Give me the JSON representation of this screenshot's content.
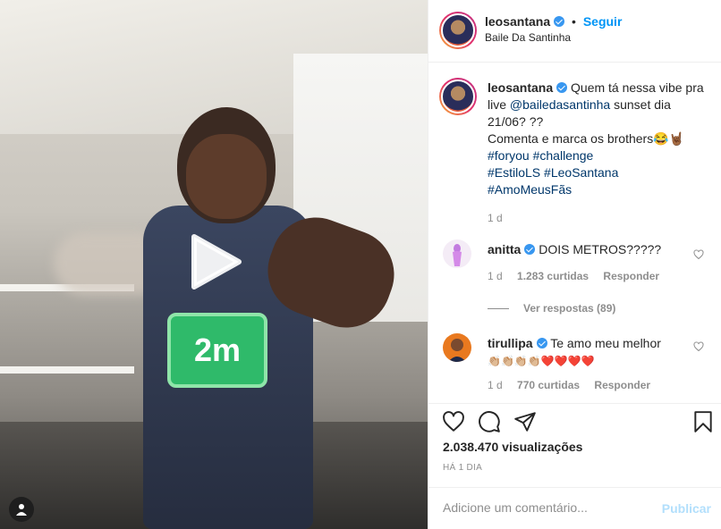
{
  "video": {
    "badge_text": "2m",
    "play_icon": "play-icon",
    "user_tag_icon": "person-icon"
  },
  "header": {
    "username": "leosantana",
    "follow_label": "Seguir",
    "separator": "•",
    "location": "Baile Da Santinha"
  },
  "caption": {
    "username": "leosantana",
    "text_before": "Quem tá nessa vibe pra live ",
    "mention": "@bailedasantinha",
    "text_after": " sunset dia 21/06? ??",
    "line2": "Comenta e marca os brothers😂🤘🏾",
    "hashtags_line1": [
      "#foryou",
      "#challenge"
    ],
    "hashtags_line2": [
      "#EstiloLS",
      "#LeoSantana"
    ],
    "hashtags_line3": [
      "#AmoMeusFãs"
    ],
    "time": "1 d"
  },
  "comments": [
    {
      "username": "anitta",
      "text": "DOIS METROS?????",
      "time": "1 d",
      "likes": "1.283 curtidas",
      "reply": "Responder",
      "replies_label": "Ver respostas (89)"
    },
    {
      "username": "tirullipa",
      "text": "Te amo meu melhor",
      "text2": "👏🏼👏🏼👏🏼👏🏼❤️❤️❤️❤️",
      "time": "1 d",
      "likes": "770 curtidas",
      "reply": "Responder"
    }
  ],
  "actions": {
    "like_icon": "heart-icon",
    "comment_icon": "comment-icon",
    "share_icon": "send-icon",
    "save_icon": "bookmark-icon",
    "views": "2.038.470 visualizações",
    "posted_ago": "HÁ 1 DIA"
  },
  "add_comment": {
    "placeholder": "Adicione um comentário...",
    "publish_label": "Publicar"
  },
  "colors": {
    "link": "#00376b",
    "follow": "#0095f6",
    "verified": "#3897f0",
    "badge": "#2fba6a",
    "muted": "#8e8e8e"
  }
}
